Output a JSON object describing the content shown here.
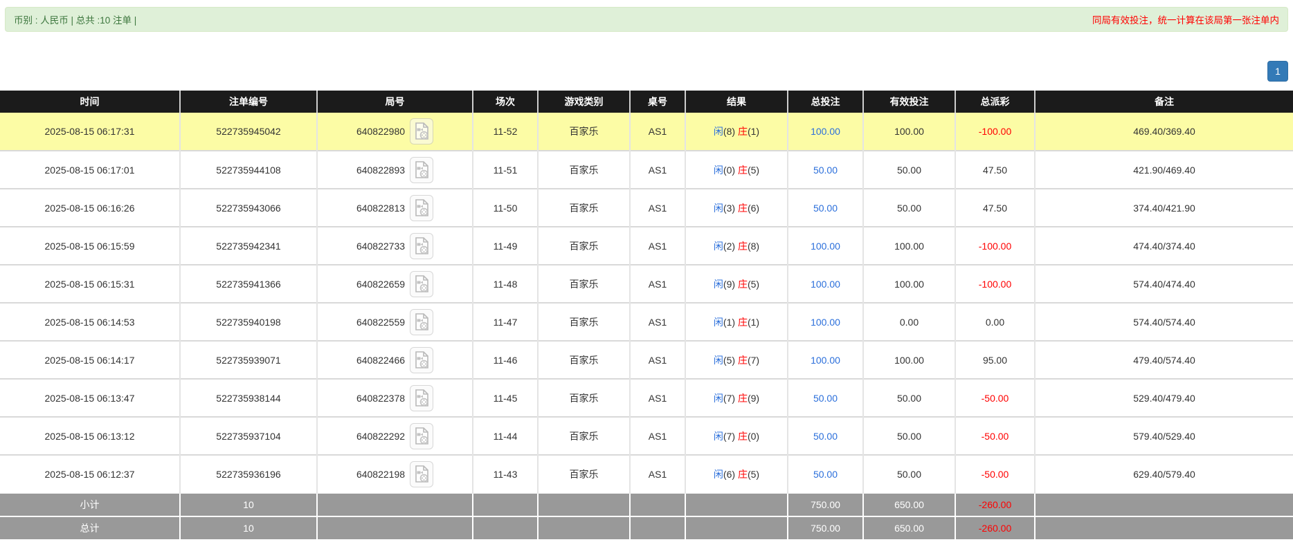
{
  "top_bar": {
    "summary": "币别 : 人民币 | 总共 :10 注单 |",
    "notice": "同局有效投注，统一计算在该局第一张注单内"
  },
  "pagination": {
    "current_page": "1"
  },
  "icons": {
    "round_media_icon": "video-record-document-icon"
  },
  "colors": {
    "bar_bg": "#dff0d8",
    "bar_text": "#3c763d",
    "notice_red": "#ff0000",
    "header_bg": "#1b1b1b",
    "highlight_row": "#fcfca5",
    "link_blue": "#2b6fdb",
    "negative_red": "#ff0000",
    "footer_bg": "#999999",
    "page_btn": "#337ab7"
  },
  "table": {
    "columns": [
      "时间",
      "注单编号",
      "局号",
      "场次",
      "游戏类别",
      "桌号",
      "结果",
      "总投注",
      "有效投注",
      "总派彩",
      "备注"
    ],
    "rows": [
      {
        "time": "2025-08-15 06:17:31",
        "bet_id": "522735945042",
        "round_id": "640822980",
        "session": "11-52",
        "game": "百家乐",
        "table_no": "AS1",
        "p_label": "闲",
        "p_val": "(8)",
        "b_label": "庄",
        "b_val": "(1)",
        "total": "100.00",
        "valid": "100.00",
        "payout": "-100.00",
        "remark": "469.40/369.40",
        "highlight": true
      },
      {
        "time": "2025-08-15 06:17:01",
        "bet_id": "522735944108",
        "round_id": "640822893",
        "session": "11-51",
        "game": "百家乐",
        "table_no": "AS1",
        "p_label": "闲",
        "p_val": "(0)",
        "b_label": "庄",
        "b_val": "(5)",
        "total": "50.00",
        "valid": "50.00",
        "payout": "47.50",
        "remark": "421.90/469.40",
        "highlight": false
      },
      {
        "time": "2025-08-15 06:16:26",
        "bet_id": "522735943066",
        "round_id": "640822813",
        "session": "11-50",
        "game": "百家乐",
        "table_no": "AS1",
        "p_label": "闲",
        "p_val": "(3)",
        "b_label": "庄",
        "b_val": "(6)",
        "total": "50.00",
        "valid": "50.00",
        "payout": "47.50",
        "remark": "374.40/421.90",
        "highlight": false
      },
      {
        "time": "2025-08-15 06:15:59",
        "bet_id": "522735942341",
        "round_id": "640822733",
        "session": "11-49",
        "game": "百家乐",
        "table_no": "AS1",
        "p_label": "闲",
        "p_val": "(2)",
        "b_label": "庄",
        "b_val": "(8)",
        "total": "100.00",
        "valid": "100.00",
        "payout": "-100.00",
        "remark": "474.40/374.40",
        "highlight": false
      },
      {
        "time": "2025-08-15 06:15:31",
        "bet_id": "522735941366",
        "round_id": "640822659",
        "session": "11-48",
        "game": "百家乐",
        "table_no": "AS1",
        "p_label": "闲",
        "p_val": "(9)",
        "b_label": "庄",
        "b_val": "(5)",
        "total": "100.00",
        "valid": "100.00",
        "payout": "-100.00",
        "remark": "574.40/474.40",
        "highlight": false
      },
      {
        "time": "2025-08-15 06:14:53",
        "bet_id": "522735940198",
        "round_id": "640822559",
        "session": "11-47",
        "game": "百家乐",
        "table_no": "AS1",
        "p_label": "闲",
        "p_val": "(1)",
        "b_label": "庄",
        "b_val": "(1)",
        "total": "100.00",
        "valid": "0.00",
        "payout": "0.00",
        "remark": "574.40/574.40",
        "highlight": false
      },
      {
        "time": "2025-08-15 06:14:17",
        "bet_id": "522735939071",
        "round_id": "640822466",
        "session": "11-46",
        "game": "百家乐",
        "table_no": "AS1",
        "p_label": "闲",
        "p_val": "(5)",
        "b_label": "庄",
        "b_val": "(7)",
        "total": "100.00",
        "valid": "100.00",
        "payout": "95.00",
        "remark": "479.40/574.40",
        "highlight": false
      },
      {
        "time": "2025-08-15 06:13:47",
        "bet_id": "522735938144",
        "round_id": "640822378",
        "session": "11-45",
        "game": "百家乐",
        "table_no": "AS1",
        "p_label": "闲",
        "p_val": "(7)",
        "b_label": "庄",
        "b_val": "(9)",
        "total": "50.00",
        "valid": "50.00",
        "payout": "-50.00",
        "remark": "529.40/479.40",
        "highlight": false
      },
      {
        "time": "2025-08-15 06:13:12",
        "bet_id": "522735937104",
        "round_id": "640822292",
        "session": "11-44",
        "game": "百家乐",
        "table_no": "AS1",
        "p_label": "闲",
        "p_val": "(7)",
        "b_label": "庄",
        "b_val": "(0)",
        "total": "50.00",
        "valid": "50.00",
        "payout": "-50.00",
        "remark": "579.40/529.40",
        "highlight": false
      },
      {
        "time": "2025-08-15 06:12:37",
        "bet_id": "522735936196",
        "round_id": "640822198",
        "session": "11-43",
        "game": "百家乐",
        "table_no": "AS1",
        "p_label": "闲",
        "p_val": "(6)",
        "b_label": "庄",
        "b_val": "(5)",
        "total": "50.00",
        "valid": "50.00",
        "payout": "-50.00",
        "remark": "629.40/579.40",
        "highlight": false
      }
    ],
    "footer": [
      {
        "label": "小计",
        "count": "10",
        "total": "750.00",
        "valid": "650.00",
        "payout": "-260.00"
      },
      {
        "label": "总计",
        "count": "10",
        "total": "750.00",
        "valid": "650.00",
        "payout": "-260.00"
      }
    ]
  }
}
